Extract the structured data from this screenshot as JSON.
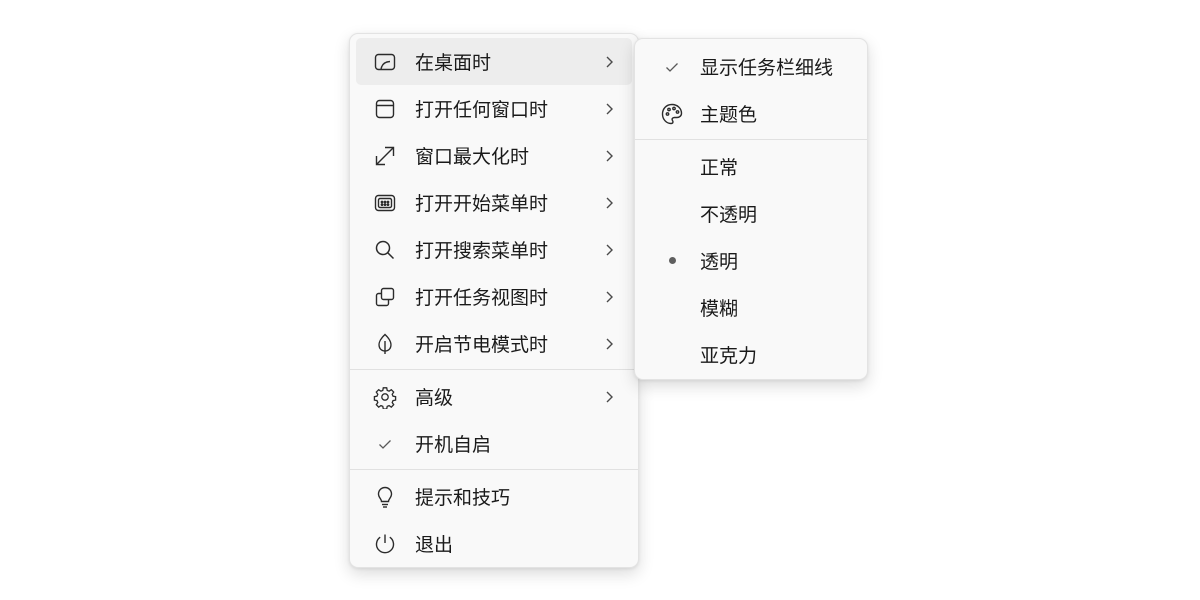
{
  "main_menu": {
    "items": [
      {
        "label": "在桌面时",
        "icon": "desktop-icon"
      },
      {
        "label": "打开任何窗口时",
        "icon": "window-icon"
      },
      {
        "label": "窗口最大化时",
        "icon": "maximize-icon"
      },
      {
        "label": "打开开始菜单时",
        "icon": "start-menu-icon"
      },
      {
        "label": "打开搜索菜单时",
        "icon": "search-icon"
      },
      {
        "label": "打开任务视图时",
        "icon": "task-view-icon"
      },
      {
        "label": "开启节电模式时",
        "icon": "leaf-icon"
      },
      {
        "label": "高级",
        "icon": "gear-icon"
      },
      {
        "label": "开机自启",
        "icon": "check-icon",
        "checked": true
      },
      {
        "label": "提示和技巧",
        "icon": "lightbulb-icon"
      },
      {
        "label": "退出",
        "icon": "power-icon"
      }
    ]
  },
  "sub_menu": {
    "items": [
      {
        "label": "显示任务栏细线",
        "icon": "check-icon",
        "checked": true
      },
      {
        "label": "主题色",
        "icon": "palette-icon"
      },
      {
        "label": "正常"
      },
      {
        "label": "不透明"
      },
      {
        "label": "透明",
        "selected": true,
        "icon": "radio-dot-icon"
      },
      {
        "label": "模糊"
      },
      {
        "label": "亚克力"
      }
    ]
  },
  "colors": {
    "menu_bg": "#f9f9f9",
    "hover_bg": "#ededed",
    "text": "#1a1a1a",
    "icon": "#2b2b2b"
  }
}
